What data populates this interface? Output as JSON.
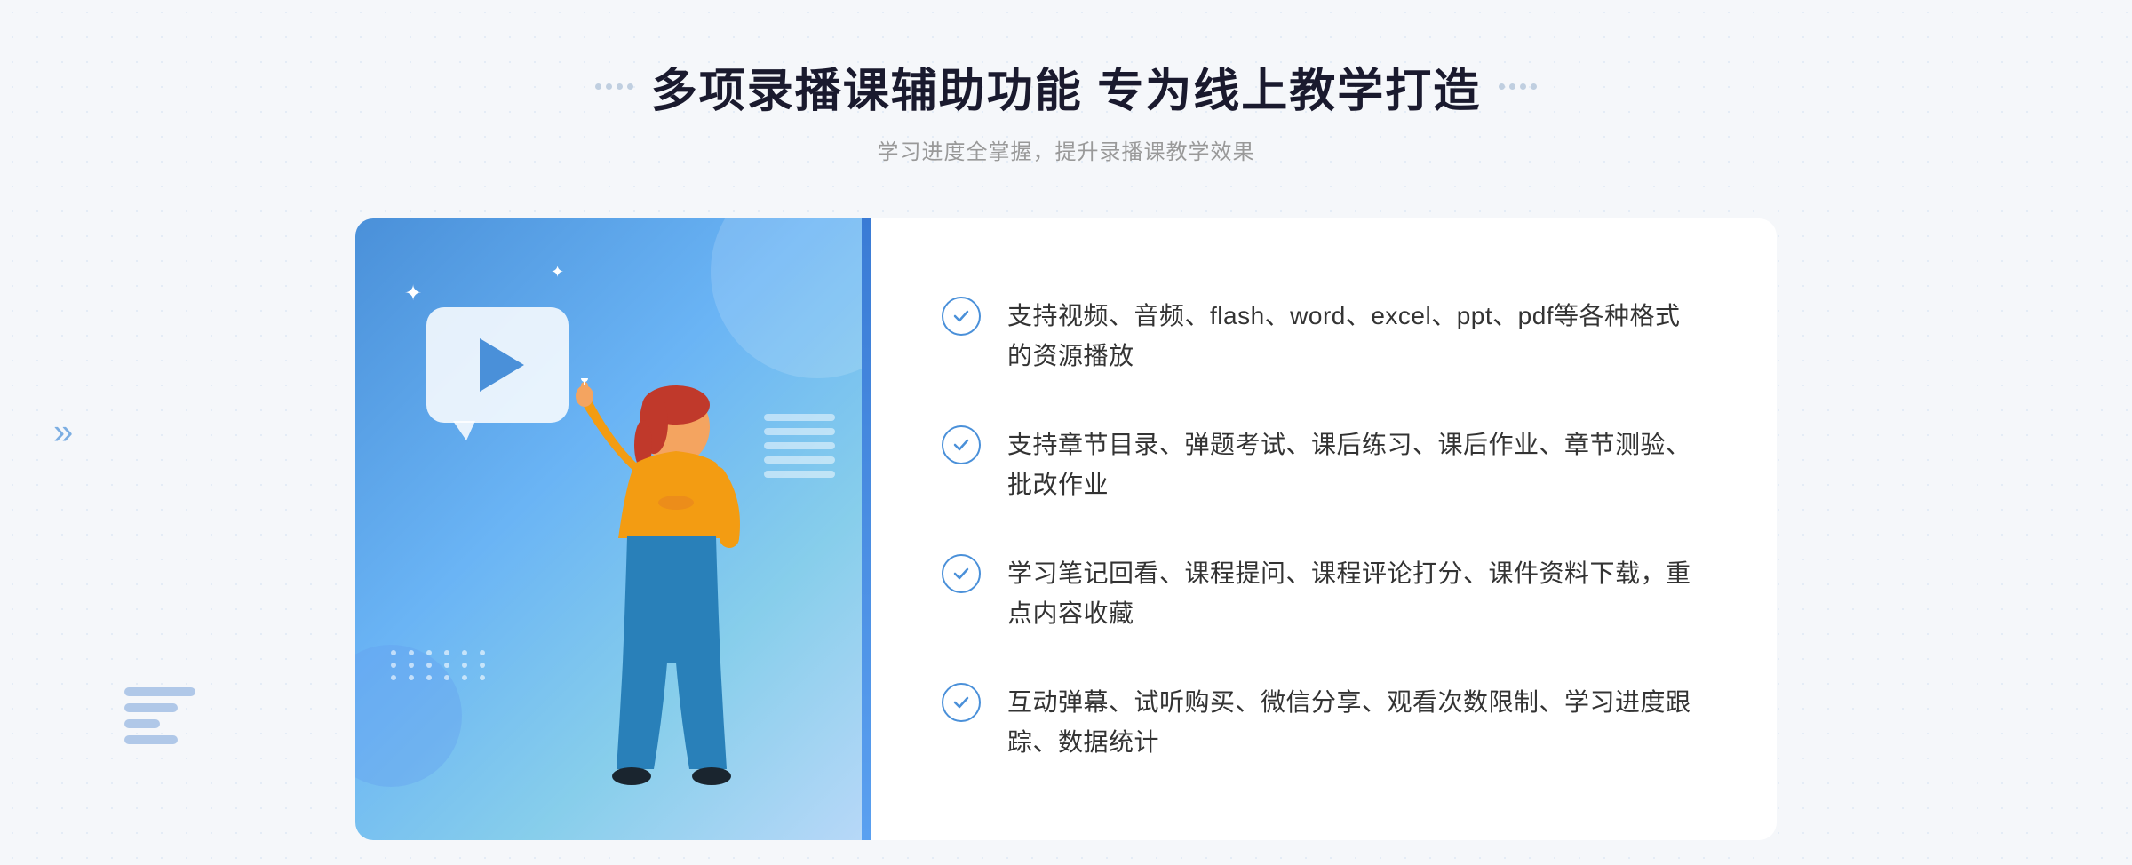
{
  "header": {
    "title": "多项录播课辅助功能 专为线上教学打造",
    "subtitle": "学习进度全掌握，提升录播课教学效果",
    "left_decorator": "⁞⁞",
    "right_decorator": "⁞⁞"
  },
  "features": [
    {
      "id": "feature-1",
      "text": "支持视频、音频、flash、word、excel、ppt、pdf等各种格式的资源播放"
    },
    {
      "id": "feature-2",
      "text": "支持章节目录、弹题考试、课后练习、课后作业、章节测验、批改作业"
    },
    {
      "id": "feature-3",
      "text": "学习笔记回看、课程提问、课程评论打分、课件资料下载，重点内容收藏"
    },
    {
      "id": "feature-4",
      "text": "互动弹幕、试听购买、微信分享、观看次数限制、学习进度跟踪、数据统计"
    }
  ],
  "colors": {
    "primary_blue": "#4a90d9",
    "light_blue": "#87ceeb",
    "text_dark": "#1a1a2e",
    "text_gray": "#999999",
    "text_body": "#333333"
  },
  "illustration": {
    "play_icon": "▶",
    "sparkle_1": "✦",
    "sparkle_2": "✦"
  },
  "navigation": {
    "left_chevron": "»"
  }
}
